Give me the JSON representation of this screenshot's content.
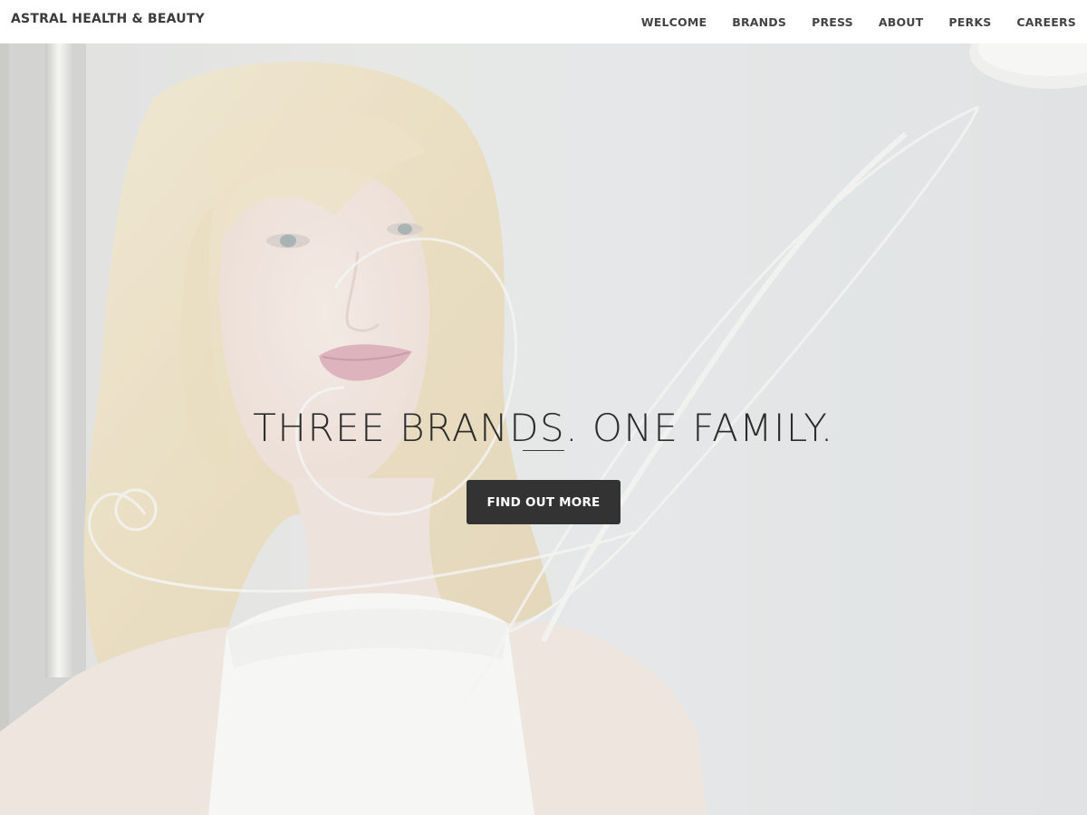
{
  "header": {
    "brand": "ASTRAL HEALTH & BEAUTY",
    "nav": [
      {
        "label": "WELCOME"
      },
      {
        "label": "BRANDS"
      },
      {
        "label": "PRESS"
      },
      {
        "label": "ABOUT"
      },
      {
        "label": "PERKS"
      },
      {
        "label": "CAREERS"
      }
    ]
  },
  "hero": {
    "headline": "THREE BRANDS. ONE FAMILY.",
    "cta_label": "FIND OUT MORE",
    "watermark_icon": "script-a-monogram-icon",
    "image": "woman-portrait-photo"
  },
  "colors": {
    "header_bg": "#ffffff",
    "button_bg": "#333333",
    "button_text": "#ffffff",
    "headline_text": "#2c2c2c",
    "nav_text": "#444444"
  }
}
